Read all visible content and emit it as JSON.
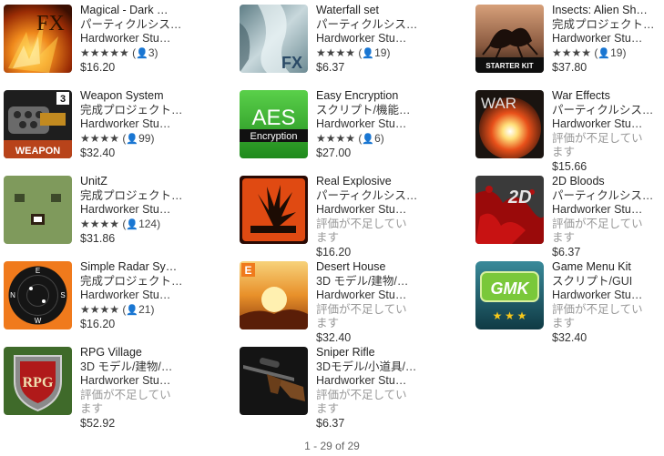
{
  "items": [
    {
      "title": "Magical - Dark …",
      "category": "パーティクルシス…",
      "publisher": "Hardworker Stu…",
      "stars": "★★★★★",
      "ratingCount": "3",
      "noRating": "",
      "price": "$16.20",
      "icon": "fire-fx-icon",
      "thumbText": "FX"
    },
    {
      "title": "Waterfall set",
      "category": "パーティクルシス…",
      "publisher": "Hardworker Stu…",
      "stars": "★★★★",
      "ratingCount": "19",
      "noRating": "",
      "price": "$6.37",
      "icon": "waterfall-icon",
      "thumbText": "FX"
    },
    {
      "title": "Insects: Alien Sh…",
      "category": "完成プロジェクト…",
      "publisher": "Hardworker Stu…",
      "stars": "★★★★",
      "ratingCount": "19",
      "noRating": "",
      "price": "$37.80",
      "icon": "insect-alien-icon",
      "thumbText": "STARTER KIT"
    },
    {
      "title": "Weapon System",
      "category": "完成プロジェクト…",
      "publisher": "Hardworker Stu…",
      "stars": "★★★★",
      "ratingCount": "99",
      "noRating": "",
      "price": "$32.40",
      "icon": "minigun-icon",
      "thumbText": "WEAPON",
      "thumbBadge": "3"
    },
    {
      "title": "Easy Encryption",
      "category": "スクリプト/機能…",
      "publisher": "Hardworker Stu…",
      "stars": "★★★★",
      "ratingCount": "6",
      "noRating": "",
      "price": "$27.00",
      "icon": "aes-encryption-icon",
      "thumbText": "AES",
      "thumbSub": "Encryption"
    },
    {
      "title": "War Effects",
      "category": "パーティクルシス…",
      "publisher": "Hardworker Stu…",
      "stars": "",
      "ratingCount": "",
      "noRating": "評価が不足しています",
      "price": "$15.66",
      "icon": "explosion-war-icon",
      "thumbText": "WAR"
    },
    {
      "title": "UnitZ",
      "category": "完成プロジェクト…",
      "publisher": "Hardworker Stu…",
      "stars": "★★★★",
      "ratingCount": "124",
      "noRating": "",
      "price": "$31.86",
      "icon": "zombie-face-icon",
      "thumbText": ""
    },
    {
      "title": "Real Explosive",
      "category": "パーティクルシス…",
      "publisher": "Hardworker Stu…",
      "stars": "",
      "ratingCount": "",
      "noRating": "評価が不足しています",
      "price": "$16.20",
      "icon": "explosive-sign-icon",
      "thumbText": ""
    },
    {
      "title": "2D Bloods",
      "category": "パーティクルシス…",
      "publisher": "Hardworker Stu…",
      "stars": "",
      "ratingCount": "",
      "noRating": "評価が不足しています",
      "price": "$6.37",
      "icon": "blood-2d-icon",
      "thumbText": "2D"
    },
    {
      "title": "Simple Radar Sy…",
      "category": "完成プロジェクト…",
      "publisher": "Hardworker Stu…",
      "stars": "★★★★",
      "ratingCount": "21",
      "noRating": "",
      "price": "$16.20",
      "icon": "radar-compass-icon",
      "thumbText": ""
    },
    {
      "title": "Desert House",
      "category": "3D モデル/建物/…",
      "publisher": "Hardworker Stu…",
      "stars": "",
      "ratingCount": "",
      "noRating": "評価が不足しています",
      "price": "$32.40",
      "icon": "desert-sun-icon",
      "thumbText": "E"
    },
    {
      "title": "Game Menu Kit",
      "category": "スクリプト/GUI",
      "publisher": "Hardworker Stu…",
      "stars": "",
      "ratingCount": "",
      "noRating": "評価が不足しています",
      "price": "$32.40",
      "icon": "gmk-menu-icon",
      "thumbText": "GMK"
    },
    {
      "title": "RPG Village",
      "category": "3D モデル/建物/…",
      "publisher": "Hardworker Stu…",
      "stars": "",
      "ratingCount": "",
      "noRating": "評価が不足しています",
      "price": "$52.92",
      "icon": "rpg-shield-icon",
      "thumbText": "RPG"
    },
    {
      "title": "Sniper Rifle",
      "category": "3Dモデル/小道具/…",
      "publisher": "Hardworker Stu…",
      "stars": "",
      "ratingCount": "",
      "noRating": "評価が不足しています",
      "price": "$6.37",
      "icon": "sniper-rifle-icon",
      "thumbText": ""
    }
  ],
  "pagination": "1 - 29 of 29"
}
